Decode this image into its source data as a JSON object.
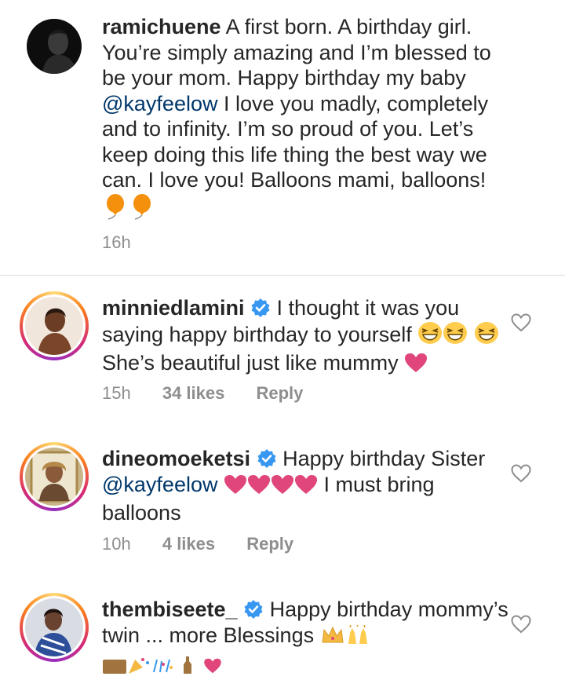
{
  "main_post": {
    "username": "ramichuene",
    "text_1": " A first born. A birthday girl. You’re simply amazing and I’m blessed to be your mom. Happy birthday my baby ",
    "mention": "@kayfeelow",
    "text_2": " I love you madly, completely and to infinity. I’m so proud of you. Let’s keep doing this life thing the best way we can. I love you! Balloons mami, balloons!",
    "time": "16h",
    "emoji_icons": [
      "balloon-icon",
      "balloon-icon"
    ]
  },
  "comments": [
    {
      "username": "minniedlamini",
      "verified": true,
      "text_1": " I thought it was you saying happy birthday to yourself ",
      "text_2": " She’s beautiful just like mummy ",
      "time": "15h",
      "likes": "34 likes",
      "reply": "Reply"
    },
    {
      "username": "dineomoeketsi",
      "verified": true,
      "text_1": " Happy birthday Sister ",
      "mention": "@kayfeelow",
      "text_2": " I must bring balloons",
      "time": "10h",
      "likes": "4 likes",
      "reply": "Reply"
    },
    {
      "username": "thembiseete_",
      "verified": true,
      "text_1": " Happy birthday mommy’s twin ... more Blessings "
    }
  ],
  "colors": {
    "text": "#262626",
    "mention": "#00376b",
    "meta": "#8e8e8e",
    "verified": "#3897f0",
    "heart": "#e0457b",
    "balloon": "#f4900c"
  }
}
